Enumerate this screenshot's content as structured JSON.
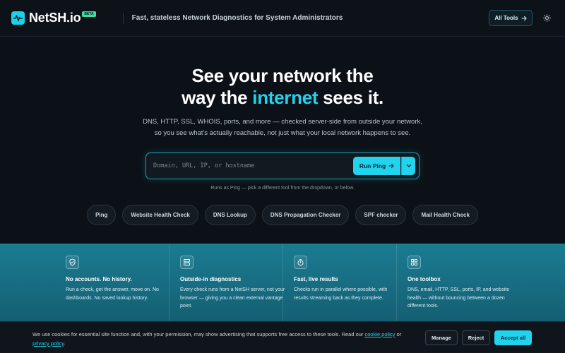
{
  "header": {
    "logo_name": "NetSH",
    "logo_tld": ".io",
    "badge": "BETA",
    "tagline": "Fast, stateless Network Diagnostics for System Administrators",
    "all_tools_label": "All Tools",
    "theme_icon": "sun-icon"
  },
  "hero": {
    "title_line1": "See your network the",
    "title_line2_before": "way the ",
    "title_line2_accent": "internet",
    "title_line2_after": " sees it.",
    "subtitle_line1": "DNS, HTTP, SSL, WHOIS, ports, and more — checked server-side from outside your network,",
    "subtitle_line2": "so you see what's actually reachable, not just what your local network happens to see.",
    "accent_color": "#22d3ee"
  },
  "search": {
    "placeholder": "Domain, URL, IP, or hostname",
    "value": "",
    "run_label": "Run Ping",
    "hint": "Runs as Ping — pick a different tool from the dropdown, or below."
  },
  "chips": [
    "Ping",
    "Website Health Check",
    "DNS Lookup",
    "DNS Propagation Checker",
    "SPF checker",
    "Mail Health Check"
  ],
  "features": [
    {
      "icon": "shield-check-icon",
      "title": "No accounts. No history.",
      "body": "Run a check, get the answer, move on. No dashboards. No saved lookup history."
    },
    {
      "icon": "server-icon",
      "title": "Outside-in diagnostics",
      "body": "Every check runs from a NetSH server, not your browser — giving you a clean external vantage point."
    },
    {
      "icon": "stopwatch-icon",
      "title": "Fast, live results",
      "body": "Checks run in parallel where possible, with results streaming back as they complete."
    },
    {
      "icon": "grid-icon",
      "title": "One toolbox",
      "body": "DNS, email, HTTP, SSL, ports, IP, and website health — without bouncing between a dozen different tools."
    }
  ],
  "cookie": {
    "text_before": "We use cookies for essential site function and, with your permission, may show advertising that supports free access to these tools. Read our ",
    "cookie_policy_link": "cookie policy",
    "text_middle": " or ",
    "privacy_policy_link": "privacy policy",
    "text_after": ".",
    "manage_label": "Manage",
    "reject_label": "Reject",
    "accept_label": "Accept all"
  }
}
